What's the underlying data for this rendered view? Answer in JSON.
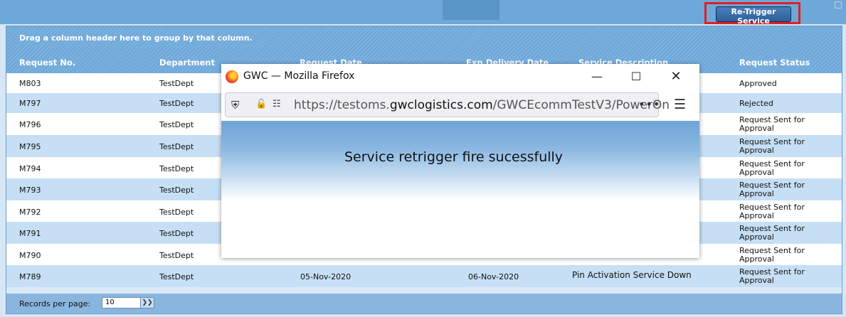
{
  "toolbar": {
    "retrigger_label": "Re-Trigger Service"
  },
  "grid": {
    "group_hint": "Drag a column header here to group by that column.",
    "columns": [
      "Request No.",
      "Department",
      "Request Date",
      "Exp.Delivery Date",
      "Service Description",
      "Request Status"
    ],
    "rows": [
      {
        "req": "M803",
        "dept": "TestDept",
        "status": "Approved"
      },
      {
        "req": "M797",
        "dept": "TestDept",
        "status": "Rejected"
      },
      {
        "req": "M796",
        "dept": "TestDept",
        "status": "Request Sent for Approval"
      },
      {
        "req": "M795",
        "dept": "TestDept",
        "status": "Request Sent for Approval"
      },
      {
        "req": "M794",
        "dept": "TestDept",
        "status": "Request Sent for Approval"
      },
      {
        "req": "M793",
        "dept": "TestDept",
        "status": "Request Sent for Approval"
      },
      {
        "req": "M792",
        "dept": "TestDept",
        "status": "Request Sent for Approval"
      },
      {
        "req": "M791",
        "dept": "TestDept",
        "status": "Request Sent for Approval"
      },
      {
        "req": "M790",
        "dept": "TestDept",
        "status": "Request Sent for Approval"
      },
      {
        "req": "M789",
        "dept": "TestDept",
        "date": "05-Nov-2020",
        "exp": "06-Nov-2020",
        "desc": "Pin Activation Service Down",
        "status": "Request Sent for Approval"
      }
    ],
    "records_per_page_label": "Records per page:",
    "records_per_page_value": "10"
  },
  "popup": {
    "window_title": "GWC — Mozilla Firefox",
    "url_prefix": "https://testoms.",
    "url_domain": "gwclogistics.com",
    "url_path": "/GWCEcommTestV3/PowerOn",
    "more_label": "•••",
    "message": "Service retrigger fire sucessfully"
  },
  "colors": {
    "accent": "#6ea8d8",
    "row_a": "#ffffff",
    "row_b": "#c6dff4",
    "highlight_border": "#e02020"
  }
}
